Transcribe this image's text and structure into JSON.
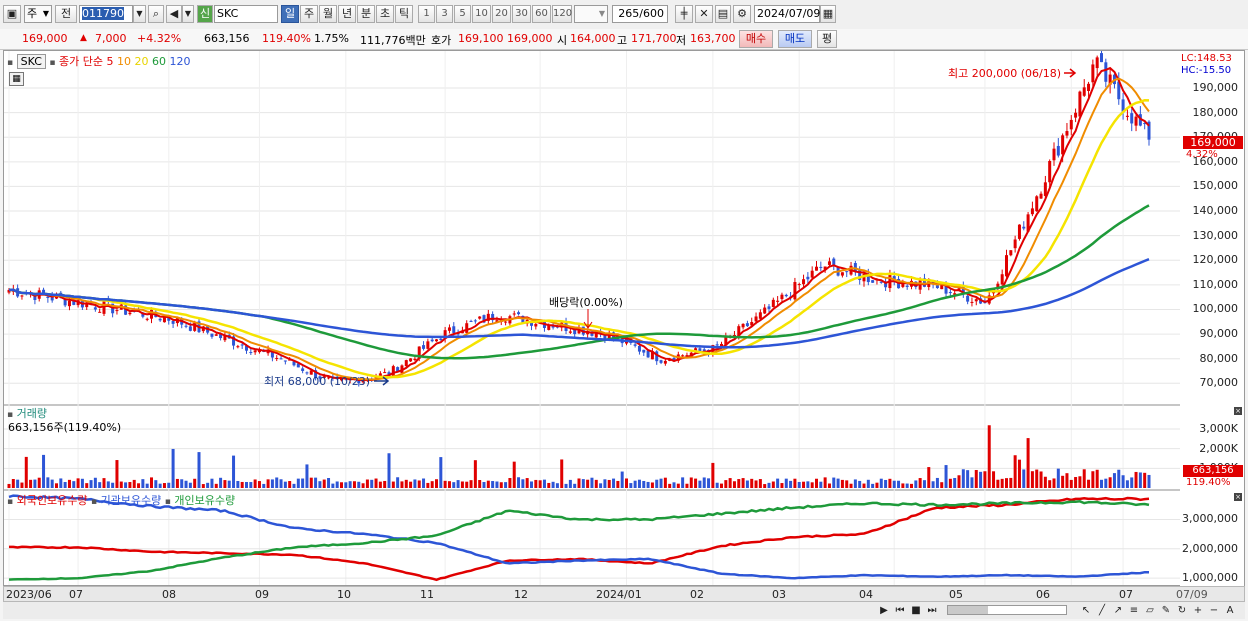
{
  "toolbar": {
    "period_select": "주",
    "prev_label": "전",
    "code_value": "011790",
    "shin_badge": "신",
    "stock_name": "SKC",
    "period_tabs": [
      "일",
      "주",
      "월",
      "년",
      "분",
      "초",
      "틱"
    ],
    "active_period": "일",
    "tick_numbers": [
      "1",
      "3",
      "5",
      "10",
      "20",
      "30",
      "60",
      "120"
    ],
    "count_value": "265",
    "count_total": "/600",
    "date_value": "2024/07/09"
  },
  "quote": {
    "price": "169,000",
    "change": "7,000",
    "change_pct": "+4.32%",
    "volume": "663,156",
    "volume_ratio": "119.40%",
    "turnover": "1.75%",
    "amount": "111,776백만",
    "ask_label": "호가",
    "ask_values": "169,100  169,000",
    "open_label": "시",
    "open_value": "164,000",
    "high_label": "고",
    "high_value": "171,700",
    "low_label": "저",
    "low_value": "163,700",
    "buy_label": "매수",
    "sell_label": "매도",
    "avg_label": "평"
  },
  "price_panel": {
    "stock_tag": "SKC",
    "legend_prefix": "종가 단순",
    "ma_periods": [
      "5",
      "10",
      "20",
      "60",
      "120"
    ],
    "ma_colors": [
      "#e00000",
      "#f08c00",
      "#f5e400",
      "#1e9a3a",
      "#2d55d6"
    ],
    "high_annotation": "최고 200,000 (06/18)",
    "low_annotation": "최저 68,000 (10/23)",
    "dividend_annotation": "배당락(0.00%)",
    "lc_label": "LC:148.53",
    "hc_label": "HC:-15.50",
    "current_price_tag": "169,000",
    "current_pct_tag": "4.32%"
  },
  "volume_panel": {
    "title": "거래량",
    "subtitle": "663,156주(119.40%)",
    "current_tag": "663,156",
    "current_pct_tag": "119.40%"
  },
  "holdings_panel": {
    "legend": [
      "외국인보유수량",
      "기관보유수량",
      "개인보유수량"
    ],
    "colors": [
      "#e00000",
      "#2d55d6",
      "#1e9a3a"
    ]
  },
  "price_axis_labels": [
    "190,000",
    "180,000",
    "170,000",
    "160,000",
    "150,000",
    "140,000",
    "130,000",
    "120,000",
    "110,000",
    "100,000",
    "90,000",
    "80,000",
    "70,000"
  ],
  "volume_axis_labels": [
    "3,000K",
    "2,000K",
    "1,000K"
  ],
  "holdings_axis_labels": [
    "3,000,000",
    "2,000,000",
    "1,000,000"
  ],
  "date_labels": [
    "2023/06",
    "07",
    "08",
    "09",
    "10",
    "11",
    "12",
    "2024/01",
    "02",
    "03",
    "04",
    "05",
    "06",
    "07",
    "07/09"
  ],
  "chart_data": {
    "type": "candlestick",
    "price_ylim": [
      62000,
      203000
    ],
    "volume_ylim": [
      0,
      3000000
    ],
    "holdings_ylim": [
      800000,
      3800000
    ],
    "months": [
      "2023/06",
      "07",
      "08",
      "09",
      "10",
      "11",
      "12",
      "2024/01",
      "02",
      "03",
      "04",
      "05",
      "06",
      "07"
    ],
    "close_by_period": [
      108000,
      104000,
      100000,
      96000,
      88000,
      80000,
      70000,
      74000,
      90000,
      98000,
      94000,
      90000,
      80000,
      84000,
      100000,
      118000,
      112000,
      110000,
      103000,
      150000,
      200000,
      169000
    ],
    "extremes": {
      "high": 200000,
      "high_date": "06/18",
      "low": 68000,
      "low_date": "10/23"
    },
    "last": {
      "price": 169000,
      "change_pct": 4.32,
      "volume": 663156
    }
  }
}
